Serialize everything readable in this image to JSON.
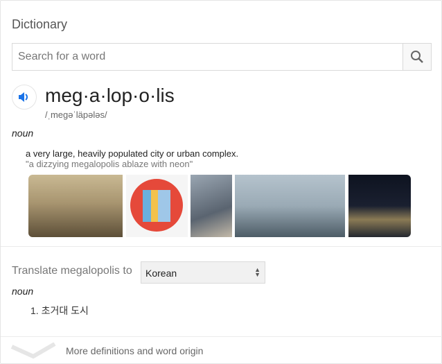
{
  "title": "Dictionary",
  "search": {
    "placeholder": "Search for a word",
    "button_icon": "search-icon"
  },
  "entry": {
    "word": "meg·a·lop·o·lis",
    "phonetic": "/ˌmeɡəˈläpələs/",
    "pos": "noun",
    "definition": "a very large, heavily populated city or urban complex.",
    "example": "\"a dizzying megalopolis ablaze with neon\""
  },
  "translate": {
    "label": "Translate megalopolis to",
    "language": "Korean",
    "pos": "noun",
    "items": [
      "1. 초거대 도시"
    ]
  },
  "more_label": "More definitions and word origin"
}
